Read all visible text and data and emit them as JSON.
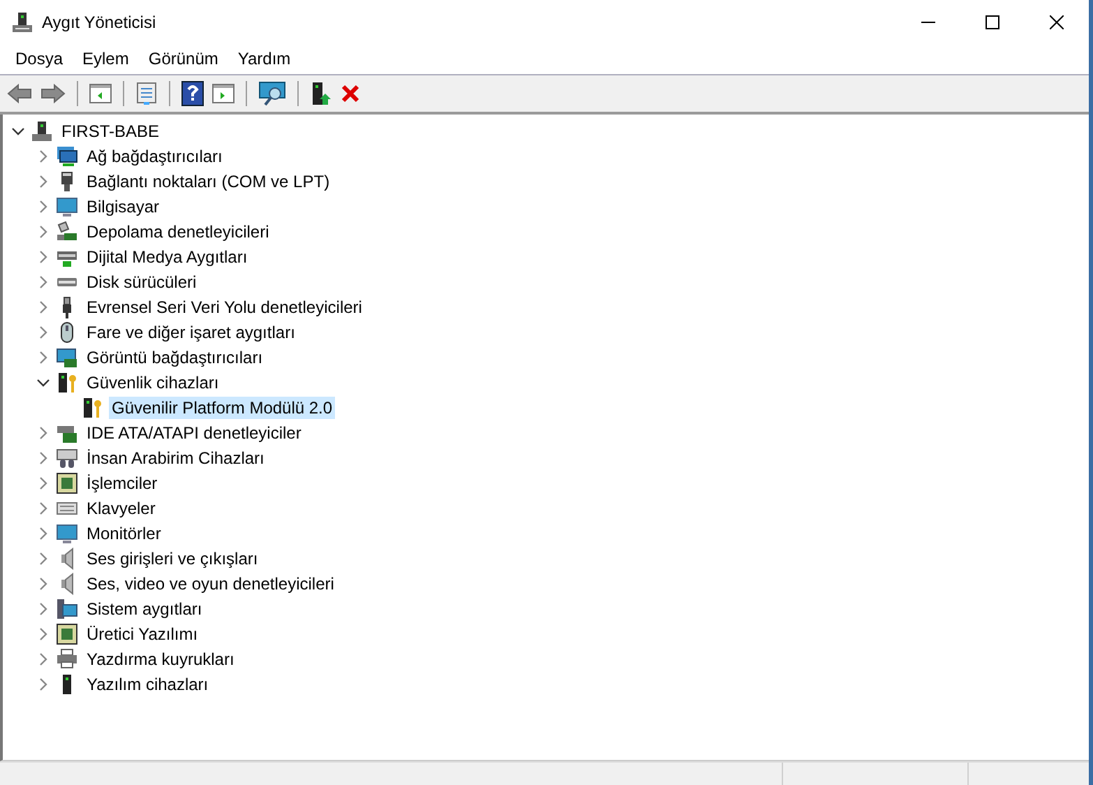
{
  "window": {
    "title": "Aygıt Yöneticisi"
  },
  "menu": [
    "Dosya",
    "Eylem",
    "Görünüm",
    "Yardım"
  ],
  "tree": {
    "label": "FIRST-BABE",
    "expanded": true,
    "selected": false,
    "children": [
      {
        "label": "Ağ bağdaştırıcıları",
        "expanded": false,
        "selected": false
      },
      {
        "label": "Bağlantı noktaları (COM ve LPT)",
        "expanded": false,
        "selected": false
      },
      {
        "label": "Bilgisayar",
        "expanded": false,
        "selected": false
      },
      {
        "label": "Depolama denetleyicileri",
        "expanded": false,
        "selected": false
      },
      {
        "label": "Dijital Medya Aygıtları",
        "expanded": false,
        "selected": false
      },
      {
        "label": "Disk sürücüleri",
        "expanded": false,
        "selected": false
      },
      {
        "label": "Evrensel Seri Veri Yolu denetleyicileri",
        "expanded": false,
        "selected": false
      },
      {
        "label": "Fare ve diğer işaret aygıtları",
        "expanded": false,
        "selected": false
      },
      {
        "label": "Görüntü bağdaştırıcıları",
        "expanded": false,
        "selected": false
      },
      {
        "label": "Güvenlik cihazları",
        "expanded": true,
        "selected": false,
        "children": [
          {
            "label": "Güvenilir Platform Modülü 2.0",
            "selected": true
          }
        ]
      },
      {
        "label": "IDE ATA/ATAPI denetleyiciler",
        "expanded": false,
        "selected": false
      },
      {
        "label": "İnsan Arabirim Cihazları",
        "expanded": false,
        "selected": false
      },
      {
        "label": "İşlemciler",
        "expanded": false,
        "selected": false
      },
      {
        "label": "Klavyeler",
        "expanded": false,
        "selected": false
      },
      {
        "label": "Monitörler",
        "expanded": false,
        "selected": false
      },
      {
        "label": "Ses girişleri ve çıkışları",
        "expanded": false,
        "selected": false
      },
      {
        "label": "Ses, video ve oyun denetleyicileri",
        "expanded": false,
        "selected": false
      },
      {
        "label": "Sistem aygıtları",
        "expanded": false,
        "selected": false
      },
      {
        "label": "Üretici Yazılımı",
        "expanded": false,
        "selected": false
      },
      {
        "label": "Yazdırma kuyrukları",
        "expanded": false,
        "selected": false
      },
      {
        "label": "Yazılım cihazları",
        "expanded": false,
        "selected": false
      }
    ]
  }
}
